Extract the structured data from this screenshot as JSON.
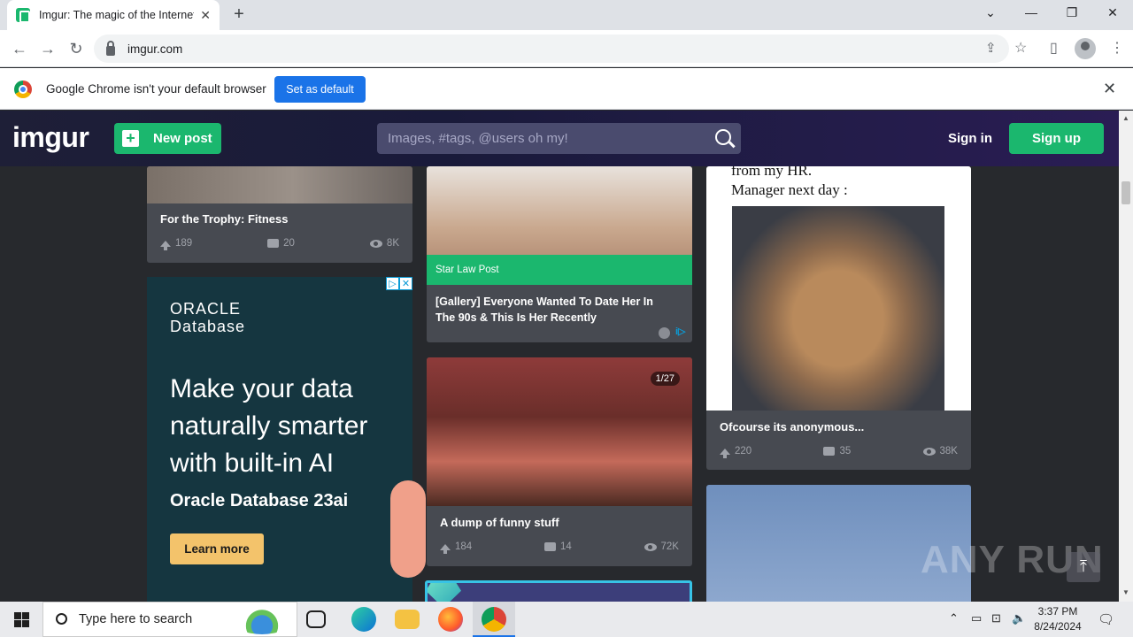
{
  "browser": {
    "tab_title": "Imgur: The magic of the Internet",
    "url": "imgur.com"
  },
  "infobar": {
    "message": "Google Chrome isn't your default browser",
    "button": "Set as default"
  },
  "imgur": {
    "logo": "imgur",
    "new_post": "New post",
    "search_placeholder": "Images, #tags, @users oh my!",
    "sign_in": "Sign in",
    "sign_up": "Sign up"
  },
  "posts": [
    {
      "title": "For the Trophy: Fitness",
      "upvotes": "189",
      "comments": "20",
      "views": "8K"
    },
    {
      "title": "[Gallery] Everyone Wanted To Date Her In The 90s & This Is Her Recently",
      "sponsor": "Star Law Post"
    },
    {
      "title": "Ofcourse its anonymous...",
      "upvotes": "220",
      "comments": "35",
      "views": "38K",
      "caption_top": "from my HR.",
      "caption_bottom": "Manager next day :"
    },
    {
      "title": "A dump of funny stuff",
      "upvotes": "184",
      "comments": "14",
      "views": "72K",
      "badge": "1/27"
    }
  ],
  "ad": {
    "brand_line1": "ORACLE",
    "brand_line2": "Database",
    "headline": "Make your data naturally smarter with built-in AI",
    "subhead": "Oracle Database 23ai",
    "cta": "Learn more"
  },
  "watermark": "ANY RUN",
  "taskbar": {
    "search_placeholder": "Type here to search",
    "time": "3:37 PM",
    "date": "8/24/2024"
  }
}
